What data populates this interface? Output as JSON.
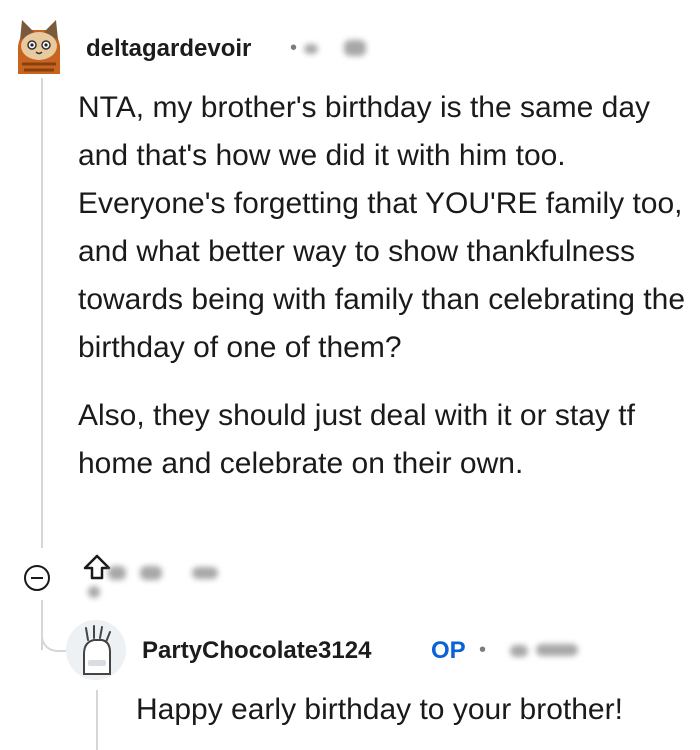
{
  "comment": {
    "username": "deltagardevoir",
    "separator": "•",
    "paragraphs": [
      "NTA, my brother's birthday is the same day and that's how we did it with him too. Everyone's forgetting that YOU'RE family too, and what better way to show thankfulness towards being with family than celebrating the birthday of one of them?",
      "Also, they should just deal with it or stay tf home and celebrate on their own."
    ]
  },
  "reply": {
    "username": "PartyChocolate3124",
    "badge": "OP",
    "separator": "•",
    "text": "Happy early birthday to your brother!"
  },
  "colors": {
    "op_badge": "#0a62d6",
    "thread_line": "#d6d6d6",
    "text": "#1a1a1b"
  },
  "icons": [
    "avatar-cat-icon",
    "collapse-icon",
    "upvote-icon",
    "avatar-hand-icon"
  ]
}
